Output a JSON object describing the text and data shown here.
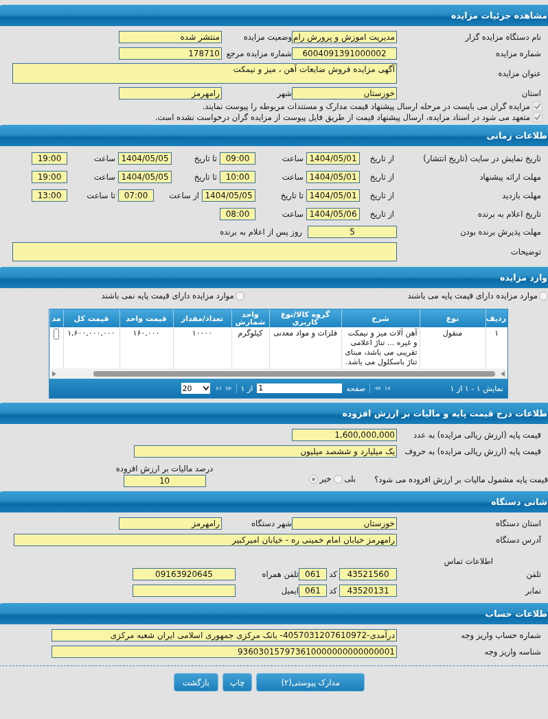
{
  "details": {
    "title": "مشاهده جزئیات مزایده",
    "organizer": {
      "label": "نام دستگاه مزایده گزار",
      "value": "مدیریت اموزش و پرورش رام"
    },
    "status": {
      "label": "وضعیت مزایده",
      "value": "منتشر شده"
    },
    "number": {
      "label": "شماره مزایده",
      "value": "6004091391000002"
    },
    "ref_number": {
      "label": "شماره مزایده مرجع",
      "value": "178710"
    },
    "subject": {
      "label": "عنوان مزایده",
      "value": "آگهی مزایده فروش ضایعات آهن ، میز و نیمکت"
    },
    "province": {
      "label": "استان",
      "value": "خوزستان"
    },
    "city": {
      "label": "شهر",
      "value": "رامهرمز"
    },
    "notices": [
      {
        "label": "مزایده گران می بایست در مرحله ارسال پیشنهاد قیمت مدارک و مستندات مربوطه را پیوست نمایند.",
        "checked": true
      },
      {
        "label": "متعهد می شود در اسناد مزایده، ارسال پیشنهاد قیمت از طریق فایل پیوست از مزایده گران درخواست نشده است.",
        "checked": true
      }
    ]
  },
  "timing": {
    "title": "طلاعات زمانی",
    "rows": [
      {
        "label": "تاریخ نمایش در سایت (تاریخ انتشار)",
        "parts": [
          {
            "label": "از تاریخ",
            "value": "1404/05/01"
          },
          {
            "label": "ساعت",
            "value": "09:00"
          },
          {
            "label": "تا تاریخ",
            "value": "1404/05/05"
          },
          {
            "label": "ساعت",
            "value": "19:00"
          }
        ]
      },
      {
        "label": "مهلت ارائه پیشنهاد",
        "parts": [
          {
            "label": "از تاریخ",
            "value": "1404/05/01"
          },
          {
            "label": "ساعت",
            "value": "10:00"
          },
          {
            "label": "تا تاریخ",
            "value": "1404/05/05"
          },
          {
            "label": "ساعت",
            "value": "19:00"
          }
        ]
      },
      {
        "label": "مهلت بازدید",
        "parts": [
          {
            "label": "از تاریخ",
            "value": "1404/05/01"
          },
          {
            "label": "تا تاریخ",
            "value": "1404/05/05"
          },
          {
            "label": "از ساعت",
            "value": "07:00"
          },
          {
            "label": "تا ساعت",
            "value": "13:00"
          }
        ]
      },
      {
        "label": "تاریخ اعلام به برنده",
        "parts": [
          {
            "label": "از تاریخ",
            "value": "1404/05/06"
          },
          {
            "label": "ساعت",
            "value": "08:00"
          }
        ]
      }
    ],
    "acceptance": {
      "label": "مهلت پذیرش برنده بودن",
      "value": "5",
      "suffix": "روز پس از اعلام به برنده"
    },
    "notes": {
      "label": "توضیحات"
    }
  },
  "items": {
    "title": "وارد مزایده",
    "options": [
      {
        "label": "موارد مزایده دارای قیمت پایه می باشند",
        "selected": false
      },
      {
        "label": "موارد مزایده دارای قیمت پایه نمی باشند",
        "selected": false
      }
    ],
    "table": {
      "columns": [
        "ردیف",
        "نوع",
        "شرح",
        "گروه کالا/نوع کاربری",
        "واحد شمارش",
        "تعداد/مقدار",
        "قیمت واحد",
        "قیمت کل",
        "مد"
      ],
      "rows": [
        [
          "۱",
          "منقول",
          "آهن آلات میز و نیمکت و غیره ... تناژ اعلامی تقریبی می باشد، مبنای تناژ باسکلول می باشد.",
          "فلزات و مواد معدنی",
          "کیلوگرم",
          "۱۰۰۰۰",
          "۱۶۰,۰۰۰",
          "۱,۶۰۰,۰۰۰,۰۰۰"
        ]
      ]
    },
    "pager": {
      "summary": "نمایش ۱ - ۱ از ۱",
      "page_label": "صفحه",
      "page": "1",
      "of": "از ۱",
      "page_size": "20"
    }
  },
  "pricing": {
    "title": "طلاعات درج قیمت پایه و مالیات بر ارزش افزوده",
    "amount": {
      "label": "قیمت پایه (ارزش ریالی مزایده) به عدد",
      "value": "1,600,000,000"
    },
    "words": {
      "label": "قیمت پایه (ارزش ریالی مزایده) به حروف",
      "value": "یک میلیارد و ششصد میلیون"
    },
    "vat_question": "قیمت پایه مشمول مالیات بر ارزش افزوده می شود؟",
    "vat_options": [
      {
        "label": "بلی",
        "selected": false
      },
      {
        "label": "خیر",
        "selected": true
      }
    ],
    "vat_percent": {
      "label": "درصد مالیات بر ارزش افزوده",
      "value": "10"
    }
  },
  "address": {
    "title": "شانی دستگاه",
    "province": {
      "label": "استان دستگاه",
      "value": "خوزستان"
    },
    "city": {
      "label": "شهر دستگاه",
      "value": "رامهرمز"
    },
    "street": {
      "label": "آدرس دستگاه",
      "value": "رامهرمز خیابان امام خمینی ره - خیابان امیرکبیر"
    },
    "contact_title": "اطلاعات تماس",
    "phone": {
      "label": "تلفن",
      "value": "43521560",
      "code_label": "کد",
      "code": "061"
    },
    "mobile": {
      "label": "تلفن همراه",
      "value": "09163920645"
    },
    "fax": {
      "label": "نمابر",
      "value": "43520131",
      "code_label": "کد",
      "code": "061"
    },
    "email": {
      "label": "ایمیل"
    }
  },
  "account": {
    "title": "طلاعات حساب",
    "number": {
      "label": "شماره حساب واریز وجه",
      "value": "درآمدی-4057031207610972- بانک مرکزی جمهوری اسلامی ایران شعبه مرکزی"
    },
    "id": {
      "label": "شناسه واریز وجه",
      "value": "936030157973610000000000000001"
    }
  },
  "buttons": [
    "مدارک پیوستی(۲)",
    "چاپ",
    "بازگشت"
  ]
}
